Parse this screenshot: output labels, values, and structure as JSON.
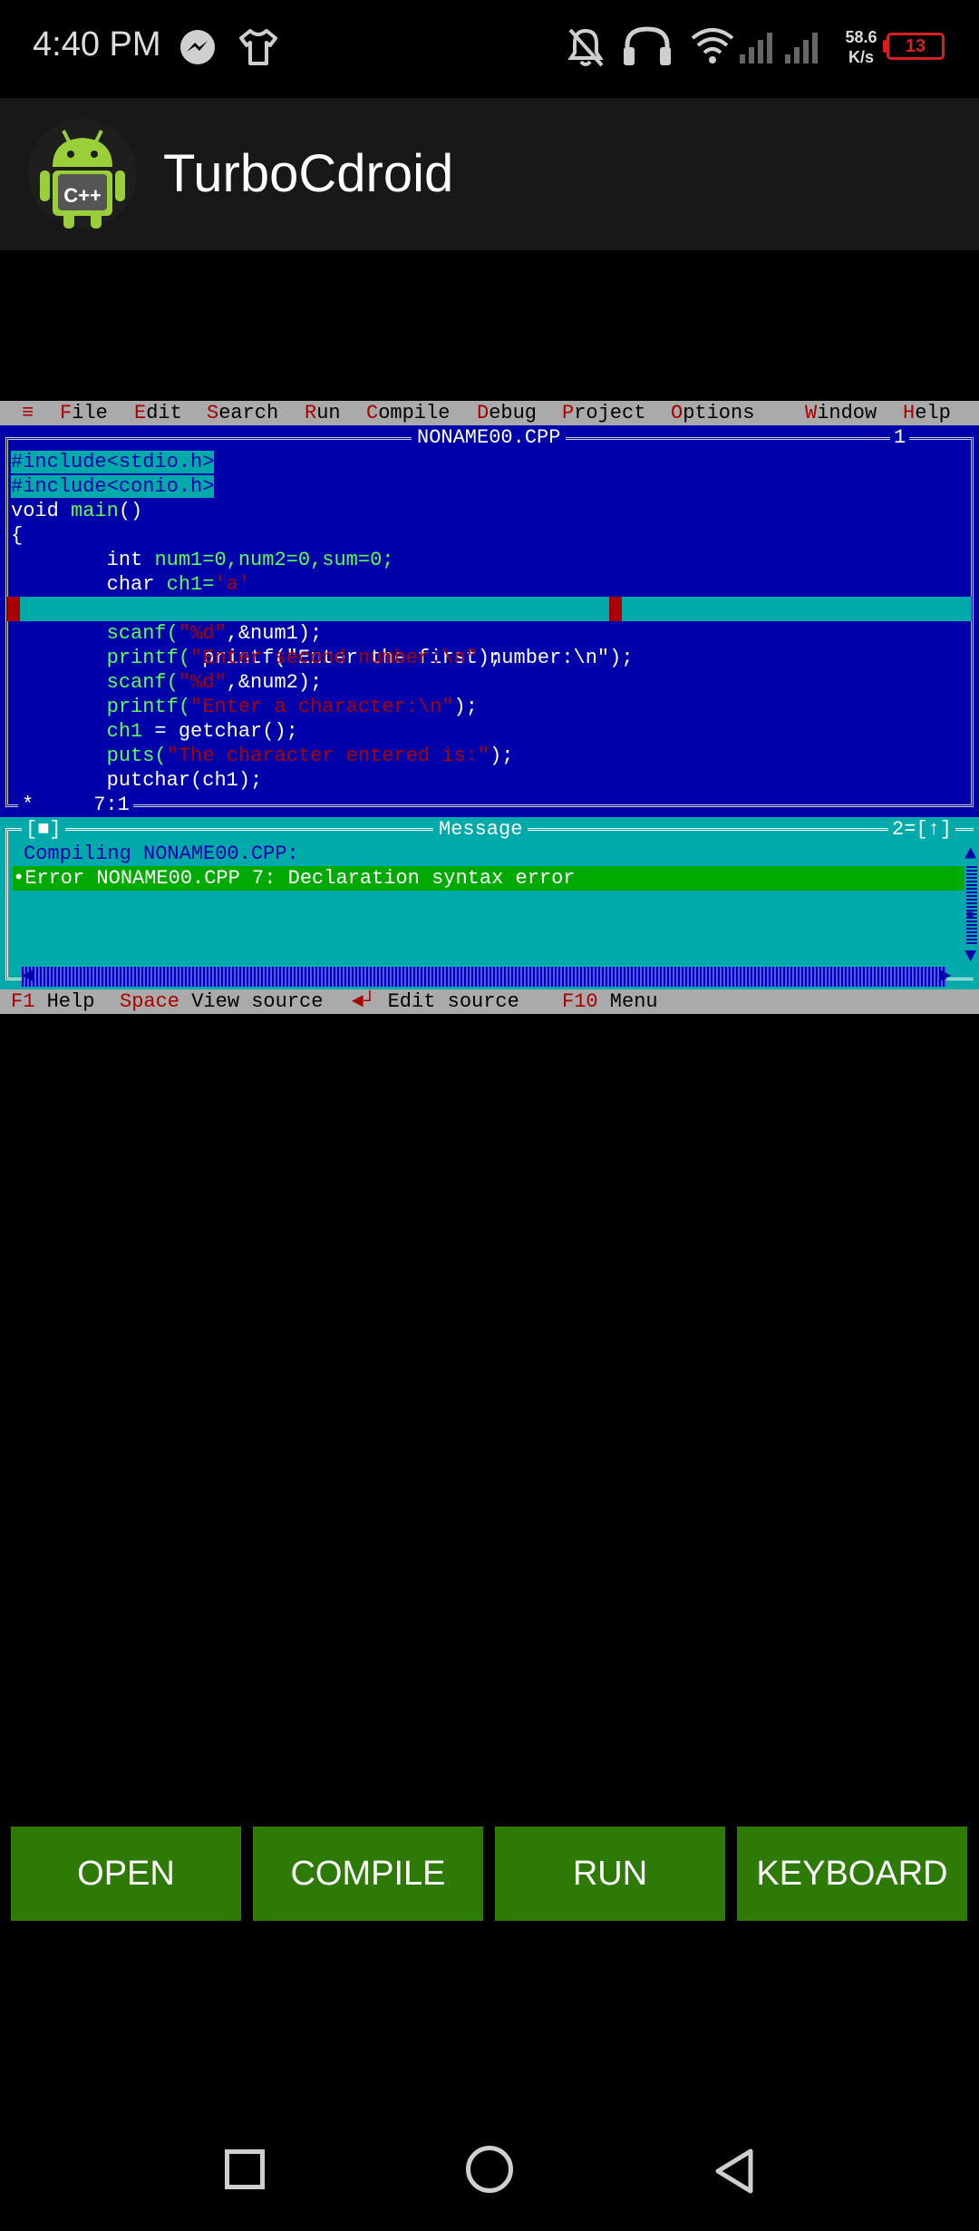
{
  "status_bar": {
    "time": "4:40 PM",
    "net_speed_value": "58.6",
    "net_speed_unit": "K/s",
    "battery_level": "13"
  },
  "app_bar": {
    "title": "TurboCdroid",
    "icon_text": "C++"
  },
  "ide": {
    "menu": [
      {
        "hot": "≡",
        "rest": ""
      },
      {
        "hot": "F",
        "rest": "ile"
      },
      {
        "hot": "E",
        "rest": "dit"
      },
      {
        "hot": "S",
        "rest": "earch"
      },
      {
        "hot": "R",
        "rest": "un"
      },
      {
        "hot": "C",
        "rest": "ompile"
      },
      {
        "hot": "D",
        "rest": "ebug"
      },
      {
        "hot": "P",
        "rest": "roject"
      },
      {
        "hot": "O",
        "rest": "ptions"
      },
      {
        "hot": "W",
        "rest": "indow"
      },
      {
        "hot": "H",
        "rest": "elp"
      }
    ],
    "editor": {
      "file_name": "NONAME00.CPP",
      "window_number": "1",
      "cursor_position": "7:1",
      "modified_marker": "*",
      "code": {
        "l1": "#include<stdio.h>",
        "l2": "#include<conio.h>",
        "l3_kw": "void",
        "l3_id": "main",
        "l3_rest": "()",
        "l4": "{",
        "l5_kw": "int",
        "l5_rest": "num1=0,num2=0,sum=0;",
        "l6_kw": "char",
        "l6_id": "ch1=",
        "l6_str": "'a'",
        "l7": "printf(\"Enter the first number:\\n\");",
        "l8_fn": "scanf(",
        "l8_str": "\"%d\"",
        "l8_rest": ",&num1);",
        "l9_fn": "printf(",
        "l9_str": "\"Enter second number:\\n\"",
        "l9_rest": ");",
        "l10_fn": "scanf(",
        "l10_str": "\"%d\"",
        "l10_rest": ",&num2);",
        "l11_fn": "printf(",
        "l11_str": "\"Enter a character:\\n\"",
        "l11_rest": ");",
        "l12_id": "ch1",
        "l12_rest": " = getchar();",
        "l13_fn": "puts(",
        "l13_str": "\"The character entered is:\"",
        "l13_rest": ");",
        "l14": "putchar(ch1);"
      }
    },
    "message": {
      "title": "Message",
      "left_control": "[■]",
      "right_control": "2=[↑]",
      "line1": "Compiling NONAME00.CPP:",
      "line2": "•Error NONAME00.CPP 7: Declaration syntax error"
    },
    "status_line": [
      {
        "key": "F1",
        "label": " Help"
      },
      {
        "key": "Space",
        "label": " View source"
      },
      {
        "key": "◄┘",
        "label": " Edit source"
      },
      {
        "key": "F10",
        "label": " Menu"
      }
    ]
  },
  "buttons": {
    "open": "OPEN",
    "compile": "COMPILE",
    "run": "RUN",
    "keyboard": "KEYBOARD"
  }
}
